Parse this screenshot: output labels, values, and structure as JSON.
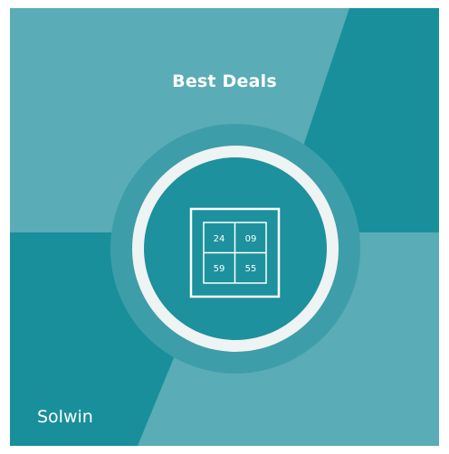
{
  "promo": {
    "title": "Best Deals",
    "brand": "Solwin",
    "countdown": [
      "24",
      "09",
      "59",
      "55"
    ]
  },
  "icons": {
    "center": "countdown-grid-icon"
  },
  "colors": {
    "light_teal": "#5aacb6",
    "dark_teal": "#1a8f9c",
    "ring": "#eef3f4",
    "halo": "#3d9ea9",
    "inner": "#1d919d"
  }
}
